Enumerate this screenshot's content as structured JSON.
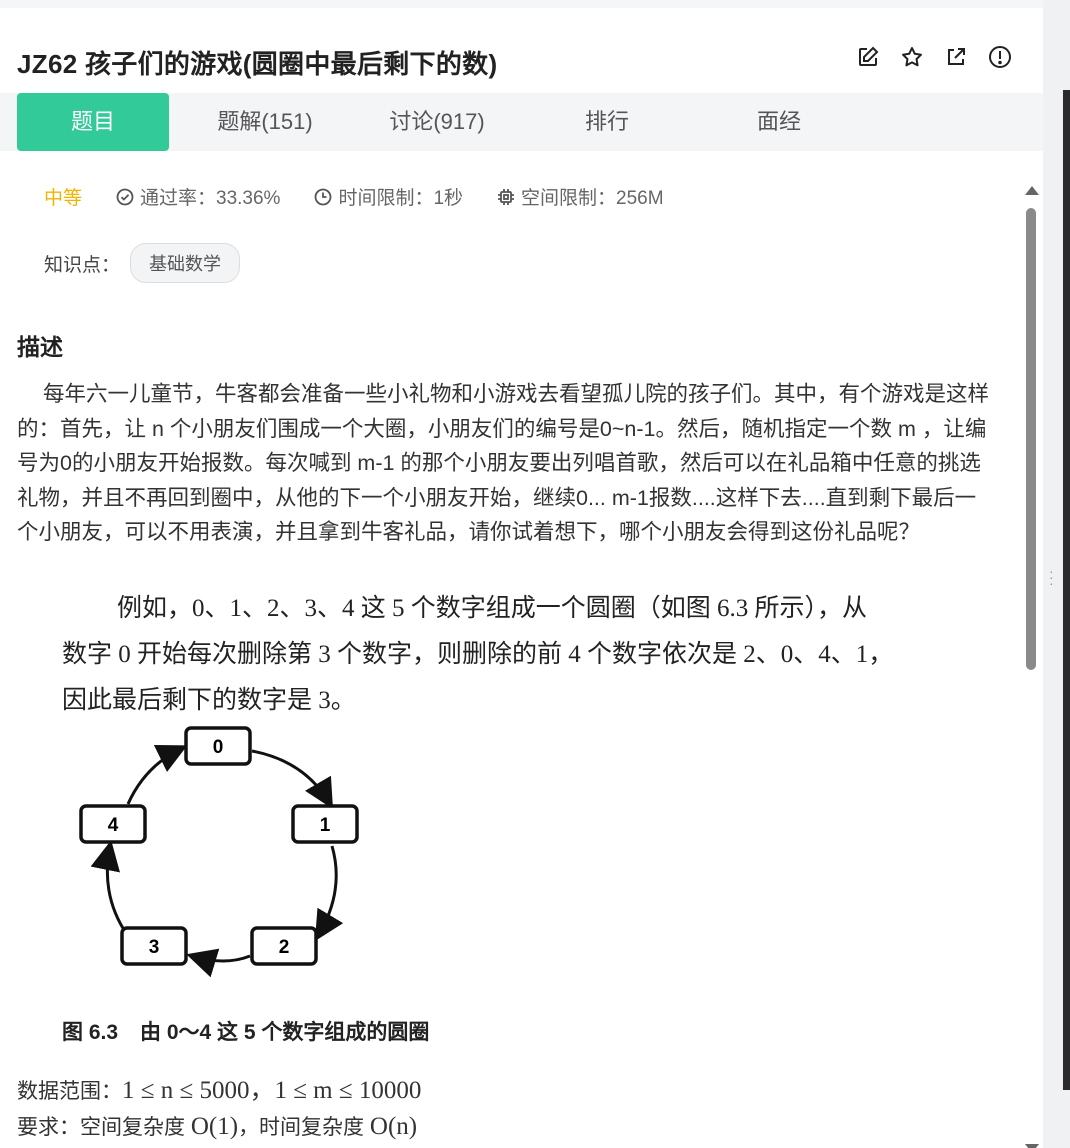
{
  "header": {
    "title": "JZ62  孩子们的游戏(圆圈中最后剩下的数)",
    "icons": [
      "edit-icon",
      "star-icon",
      "external-link-icon",
      "alert-icon"
    ]
  },
  "tabs": [
    {
      "label": "题目",
      "active": true
    },
    {
      "label": "题解(151)"
    },
    {
      "label": "讨论(917)"
    },
    {
      "label": "排行"
    },
    {
      "label": "面经"
    }
  ],
  "meta": {
    "difficulty": "中等",
    "pass_rate": "通过率：33.36%",
    "time_limit": "时间限制：1秒",
    "space_limit": "空间限制：256M"
  },
  "knowledge": {
    "label": "知识点：",
    "tag": "基础数学"
  },
  "description": {
    "heading": "描述",
    "text": "每年六一儿童节，牛客都会准备一些小礼物和小游戏去看望孤儿院的孩子们。其中，有个游戏是这样的：首先，让 n 个小朋友们围成一个大圈，小朋友们的编号是0~n-1。然后，随机指定一个数 m ，让编号为0的小朋友开始报数。每次喊到 m-1 的那个小朋友要出列唱首歌，然后可以在礼品箱中任意的挑选礼物，并且不再回到圈中，从他的下一个小朋友开始，继续0... m-1报数....这样下去....直到剩下最后一个小朋友，可以不用表演，并且拿到牛客礼品，请你试着想下，哪个小朋友会得到这份礼品呢？"
  },
  "book_excerpt": {
    "line1": "例如，0、1、2、3、4 这 5 个数字组成一个圆圈（如图 6.3 所示），从",
    "line2": "数字 0 开始每次删除第 3 个数字，则删除的前 4 个数字依次是 2、0、4、1，",
    "line3": "因此最后剩下的数字是 3。"
  },
  "figure": {
    "nodes": [
      "0",
      "1",
      "2",
      "3",
      "4"
    ],
    "caption_label": "图 6.3",
    "caption_text": "由 0～4 这 5 个数字组成的圆圈"
  },
  "constraints": {
    "range_label": "数据范围：",
    "range_math": "1 ≤ n ≤ 5000，1 ≤ m ≤ 10000",
    "req_label": "要求：空间复杂度 ",
    "req_space": "O(1)",
    "req_mid": "，时间复杂度 ",
    "req_time": "O(n)"
  }
}
